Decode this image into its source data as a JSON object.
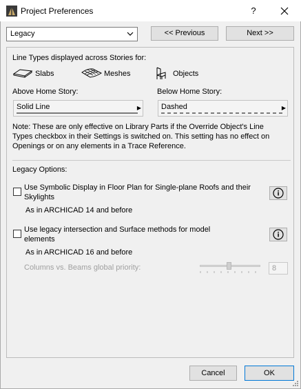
{
  "window": {
    "title": "Project Preferences",
    "help_label": "?"
  },
  "nav": {
    "dropdown_value": "Legacy",
    "previous_label": "<< Previous",
    "next_label": "Next >>"
  },
  "line_types": {
    "heading": "Line Types displayed across Stories for:",
    "categories": [
      {
        "label": "Slabs",
        "icon": "slab-icon"
      },
      {
        "label": "Meshes",
        "icon": "mesh-icon"
      },
      {
        "label": "Objects",
        "icon": "chair-icon"
      }
    ],
    "above_label": "Above Home Story:",
    "above_value": "Solid Line",
    "below_label": "Below Home Story:",
    "below_value": "Dashed",
    "note_lines": [
      "Note: These are only effective on Library Parts if the Override Object's Line",
      "Types checkbox in their Settings is switched on. This setting has no effect on",
      "Openings or on any elements in a Trace Reference."
    ]
  },
  "legacy": {
    "heading": "Legacy Options:",
    "option1": {
      "lines": [
        "Use Symbolic Display in Floor Plan for Single-plane Roofs and their",
        "Skylights"
      ],
      "sub": "As in ARCHICAD 14 and before",
      "checked": false
    },
    "option2": {
      "lines": [
        "Use legacy intersection and Surface methods for model",
        "elements"
      ],
      "sub": "As in ARCHICAD 16 and before",
      "checked": false
    },
    "priority_label": "Columns vs. Beams global priority:",
    "priority_value": "8"
  },
  "footer": {
    "cancel_label": "Cancel",
    "ok_label": "OK"
  }
}
